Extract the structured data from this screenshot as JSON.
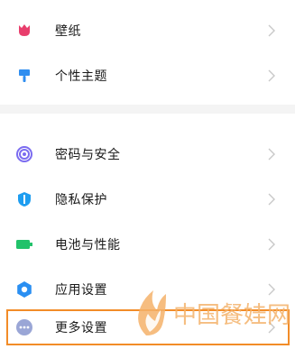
{
  "settings_top": [
    {
      "label": "壁纸",
      "icon": "tulip-icon",
      "color": "#e83e6c"
    },
    {
      "label": "个性主题",
      "icon": "paint-roller-icon",
      "color": "#2f8ef0"
    }
  ],
  "settings_bottom": [
    {
      "label": "密码与安全",
      "icon": "fingerprint-icon",
      "color": "#7b6cf0"
    },
    {
      "label": "隐私保护",
      "icon": "shield-icon",
      "color": "#1e9df0"
    },
    {
      "label": "电池与性能",
      "icon": "battery-icon",
      "color": "#21c26a"
    },
    {
      "label": "应用设置",
      "icon": "gear-icon",
      "color": "#2a8ff2"
    },
    {
      "label": "更多设置",
      "icon": "more-dots-icon",
      "color": "#9aa6d6"
    }
  ],
  "watermark": {
    "text": "中国餐娃网"
  },
  "colors": {
    "highlight": "#f28c28",
    "chevron": "#c8c8c8"
  }
}
